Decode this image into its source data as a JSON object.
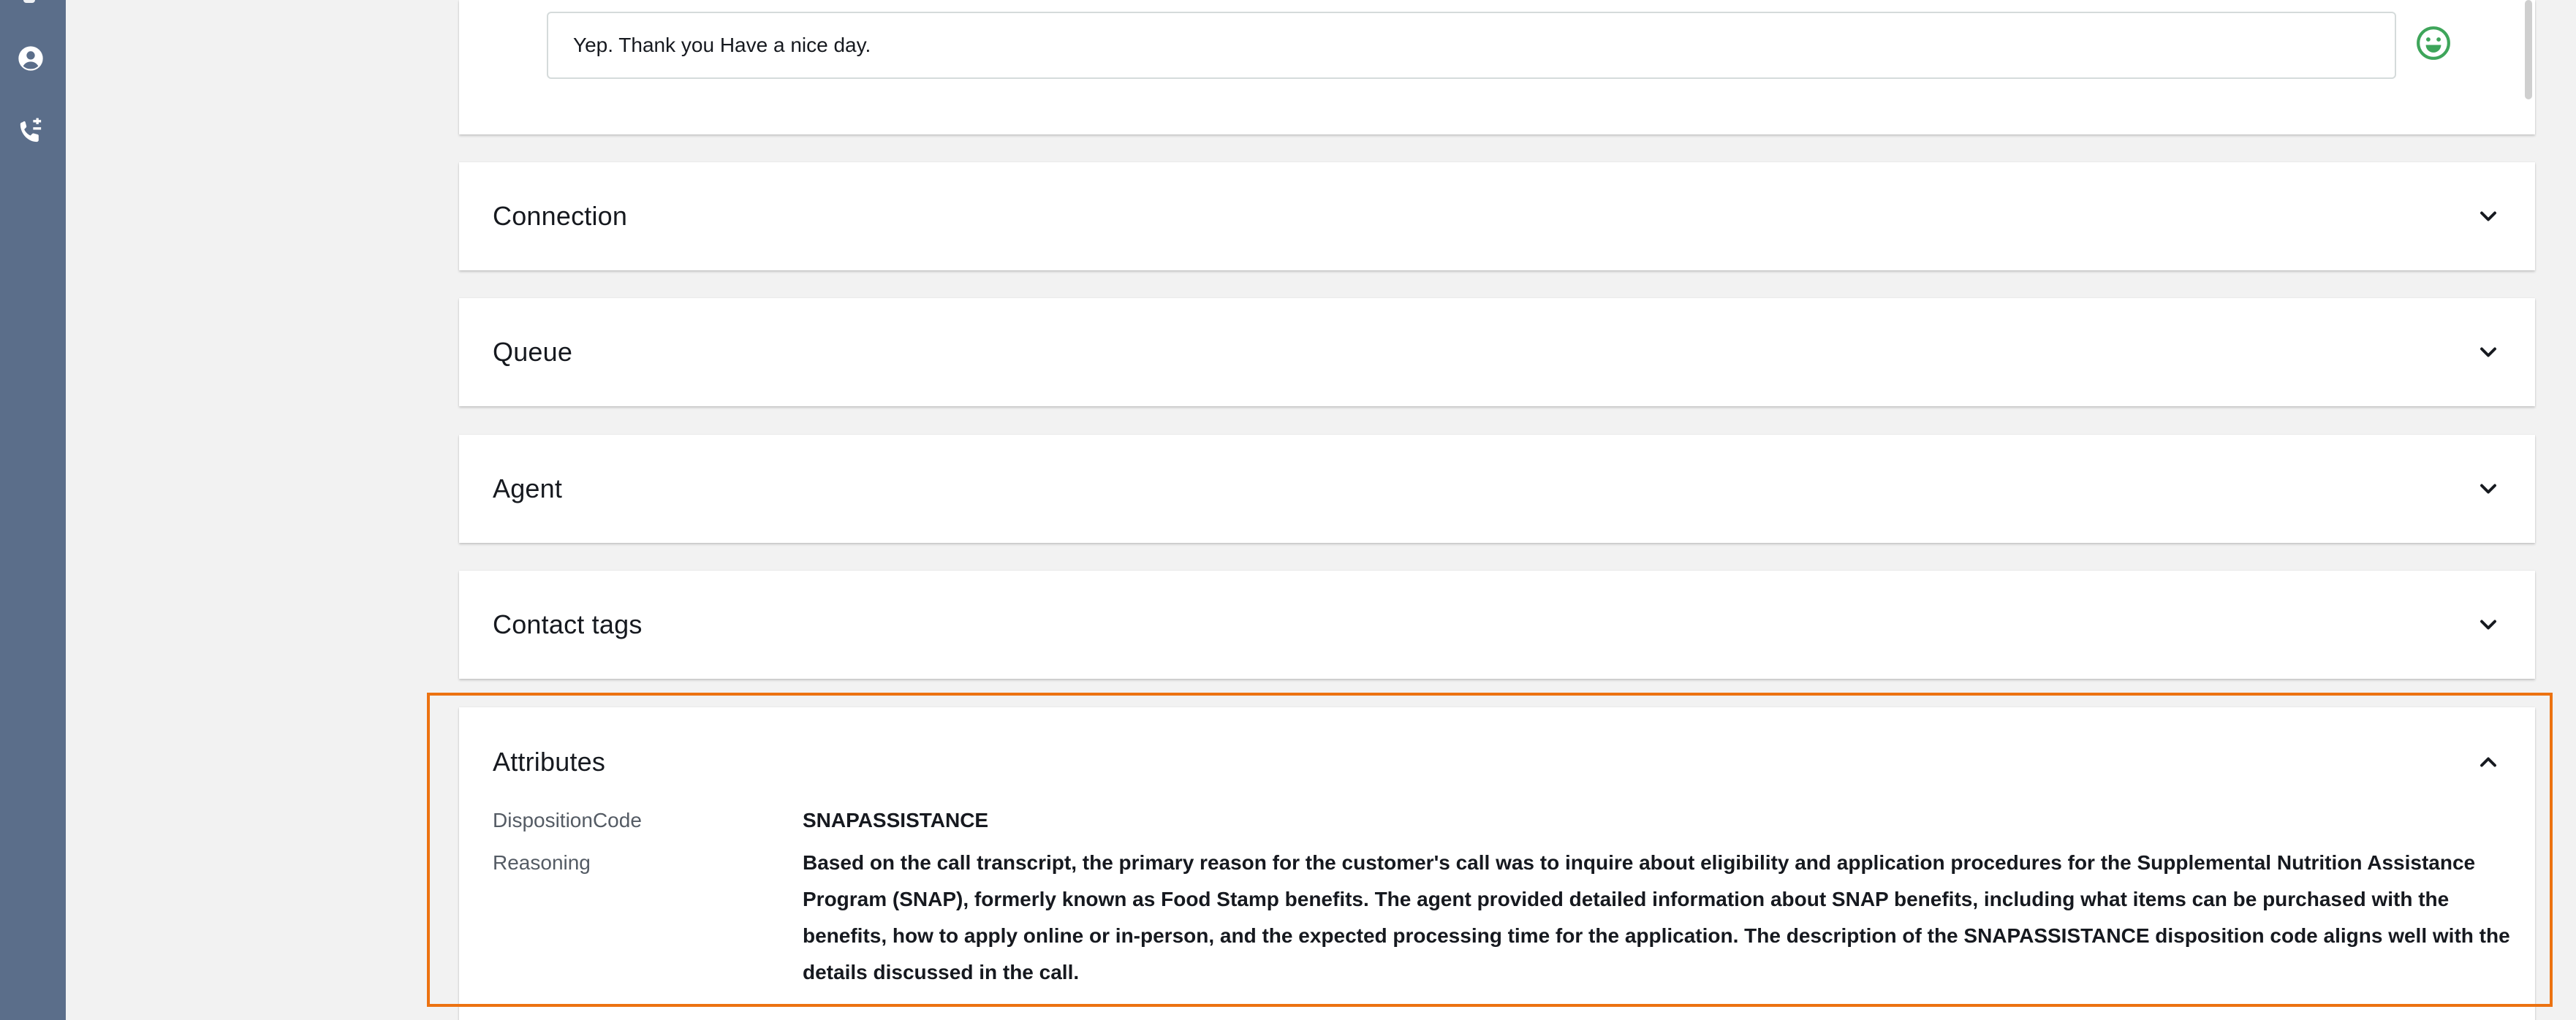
{
  "sidebar": {
    "icons": [
      {
        "name": "user-circle-icon"
      },
      {
        "name": "phone-transfer-icon"
      }
    ]
  },
  "transcript": {
    "last_message": "Yep. Thank you Have a nice day.",
    "sentiment_icon": "smiley-positive-icon",
    "sentiment_color": "#3ea55a"
  },
  "sections": {
    "connection": {
      "title": "Connection",
      "state": "collapsed"
    },
    "queue": {
      "title": "Queue",
      "state": "collapsed"
    },
    "agent": {
      "title": "Agent",
      "state": "collapsed"
    },
    "contact_tags": {
      "title": "Contact tags",
      "state": "collapsed"
    },
    "attributes": {
      "title": "Attributes",
      "state": "expanded",
      "rows": [
        {
          "key": "DispositionCode",
          "value": "SNAPASSISTANCE"
        },
        {
          "key": "Reasoning",
          "value": "Based on the call transcript, the primary reason for the customer's call was to inquire about eligibility and application procedures for the Supplemental Nutrition Assistance Program (SNAP), formerly known as Food Stamp benefits. The agent provided detailed information about SNAP benefits, including what items can be purchased with the benefits, how to apply online or in-person, and the expected processing time for the application. The description of the SNAPASSISTANCE disposition code aligns well with the details discussed in the call."
        }
      ]
    }
  },
  "colors": {
    "rail": "#5b6e8a",
    "highlight": "#ec7211",
    "background": "#f2f2f2"
  }
}
